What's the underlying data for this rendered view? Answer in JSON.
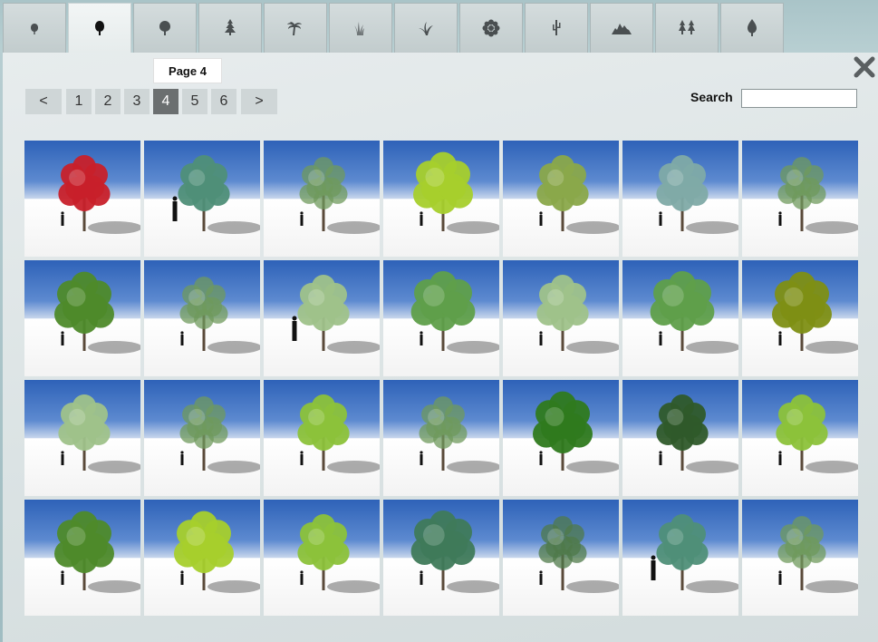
{
  "tabs": [
    {
      "name": "tab-shrub",
      "icon": "small-tree-icon",
      "active": false
    },
    {
      "name": "tab-broadleaf",
      "icon": "broadleaf-tree-icon",
      "active": true
    },
    {
      "name": "tab-round-tree",
      "icon": "round-tree-icon",
      "active": false
    },
    {
      "name": "tab-conifer",
      "icon": "conifer-tree-icon",
      "active": false
    },
    {
      "name": "tab-palm",
      "icon": "palm-tree-icon",
      "active": false
    },
    {
      "name": "tab-grass",
      "icon": "grass-icon",
      "active": false
    },
    {
      "name": "tab-plant",
      "icon": "plant-icon",
      "active": false
    },
    {
      "name": "tab-flower",
      "icon": "flower-icon",
      "active": false
    },
    {
      "name": "tab-cactus",
      "icon": "cactus-icon",
      "active": false
    },
    {
      "name": "tab-rocks",
      "icon": "rocks-icon",
      "active": false
    },
    {
      "name": "tab-forest",
      "icon": "forest-icon",
      "active": false
    },
    {
      "name": "tab-leaf",
      "icon": "leaf-icon",
      "active": false
    }
  ],
  "tooltip": "Page 4",
  "pager": {
    "prev": "<",
    "next": ">",
    "pages": [
      "1",
      "2",
      "3",
      "4",
      "5",
      "6"
    ],
    "current": "4"
  },
  "search": {
    "label": "Search",
    "value": "",
    "placeholder": ""
  },
  "thumbnails": [
    {
      "style": "red",
      "person": "small"
    },
    {
      "style": "teal",
      "person": "big"
    },
    {
      "style": "airy",
      "person": "small"
    },
    {
      "style": "lime-dense",
      "person": "small"
    },
    {
      "style": "olive",
      "person": "small"
    },
    {
      "style": "blue-green",
      "person": "small"
    },
    {
      "style": "airy",
      "person": "small"
    },
    {
      "style": "dense",
      "person": "small"
    },
    {
      "style": "airy",
      "person": "small"
    },
    {
      "style": "pale",
      "person": "big"
    },
    {
      "style": "spread",
      "person": "small"
    },
    {
      "style": "pale",
      "person": "small"
    },
    {
      "style": "spread",
      "person": "small"
    },
    {
      "style": "olive-dense",
      "person": "small"
    },
    {
      "style": "pale",
      "person": "small"
    },
    {
      "style": "airy",
      "person": "small"
    },
    {
      "style": "lime",
      "person": "small"
    },
    {
      "style": "airy",
      "person": "small"
    },
    {
      "style": "dark-dense",
      "person": "small"
    },
    {
      "style": "dark",
      "person": "small"
    },
    {
      "style": "lime",
      "person": "small"
    },
    {
      "style": "dense",
      "person": "small"
    },
    {
      "style": "lime-dense",
      "person": "small"
    },
    {
      "style": "lime",
      "person": "small"
    },
    {
      "style": "teal-wide",
      "person": "small"
    },
    {
      "style": "sparse",
      "person": "small"
    },
    {
      "style": "teal",
      "person": "big"
    },
    {
      "style": "airy",
      "person": "small"
    }
  ],
  "colors": {
    "red": "#c8202a",
    "teal": "#4f8f78",
    "airy": "#6f9a5c",
    "lime-dense": "#a6cf2c",
    "olive": "#8aa84a",
    "blue-green": "#7faaa6",
    "dense": "#4e8a2a",
    "pale": "#9fc28a",
    "spread": "#5f9f4a",
    "olive-dense": "#7e8f14",
    "lime": "#8cc23a",
    "dark-dense": "#2f7a1e",
    "dark": "#2f5a2a",
    "teal-wide": "#3f7a5a",
    "sparse": "#4f7a4a"
  }
}
